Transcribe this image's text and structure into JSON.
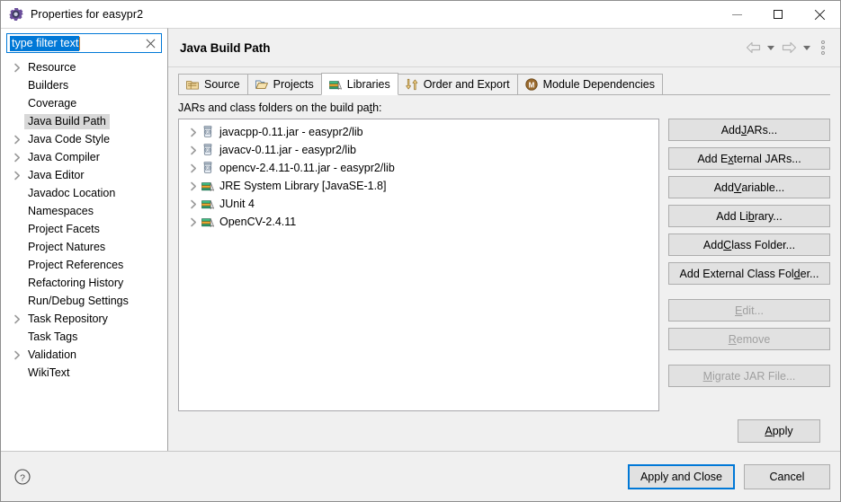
{
  "window": {
    "title": "Properties for easypr2",
    "icon": "properties-gear-icon",
    "minimize_label": "Minimize",
    "maximize_label": "Maximize",
    "close_label": "Close"
  },
  "filter": {
    "value": "type filter text",
    "placeholder": "type filter text",
    "clear_label": "Clear"
  },
  "sidebar": {
    "items": [
      {
        "label": "Resource",
        "expandable": true,
        "selected": false
      },
      {
        "label": "Builders",
        "expandable": false,
        "selected": false
      },
      {
        "label": "Coverage",
        "expandable": false,
        "selected": false
      },
      {
        "label": "Java Build Path",
        "expandable": false,
        "selected": true
      },
      {
        "label": "Java Code Style",
        "expandable": true,
        "selected": false
      },
      {
        "label": "Java Compiler",
        "expandable": true,
        "selected": false
      },
      {
        "label": "Java Editor",
        "expandable": true,
        "selected": false
      },
      {
        "label": "Javadoc Location",
        "expandable": false,
        "selected": false
      },
      {
        "label": "Namespaces",
        "expandable": false,
        "selected": false
      },
      {
        "label": "Project Facets",
        "expandable": false,
        "selected": false
      },
      {
        "label": "Project Natures",
        "expandable": false,
        "selected": false
      },
      {
        "label": "Project References",
        "expandable": false,
        "selected": false
      },
      {
        "label": "Refactoring History",
        "expandable": false,
        "selected": false
      },
      {
        "label": "Run/Debug Settings",
        "expandable": false,
        "selected": false
      },
      {
        "label": "Task Repository",
        "expandable": true,
        "selected": false
      },
      {
        "label": "Task Tags",
        "expandable": false,
        "selected": false
      },
      {
        "label": "Validation",
        "expandable": true,
        "selected": false
      },
      {
        "label": "WikiText",
        "expandable": false,
        "selected": false
      }
    ]
  },
  "page": {
    "title": "Java Build Path",
    "nav": {
      "back_label": "Back",
      "back_menu_label": "Back history",
      "forward_label": "Forward",
      "forward_menu_label": "Forward history",
      "menu_label": "View Menu"
    }
  },
  "tabs": [
    {
      "label": "Source",
      "icon": "source-package-icon",
      "active": false
    },
    {
      "label": "Projects",
      "icon": "projects-folder-icon",
      "active": false
    },
    {
      "label": "Libraries",
      "icon": "libraries-books-icon",
      "active": true
    },
    {
      "label": "Order and Export",
      "icon": "order-export-arrows-icon",
      "active": false
    },
    {
      "label": "Module Dependencies",
      "icon": "module-badge-icon",
      "active": false
    }
  ],
  "libraries": {
    "list_label_prefix": "JARs and class folders on the build pa",
    "list_label_mnemonic": "t",
    "list_label_suffix": "h:",
    "entries": [
      {
        "label": "javacpp-0.11.jar - easypr2/lib",
        "icon": "jar-icon",
        "expandable": true
      },
      {
        "label": "javacv-0.11.jar - easypr2/lib",
        "icon": "jar-icon",
        "expandable": true
      },
      {
        "label": "opencv-2.4.11-0.11.jar - easypr2/lib",
        "icon": "jar-icon",
        "expandable": true
      },
      {
        "label": "JRE System Library [JavaSE-1.8]",
        "icon": "library-icon",
        "expandable": true
      },
      {
        "label": "JUnit 4",
        "icon": "library-icon",
        "expandable": true
      },
      {
        "label": "OpenCV-2.4.11",
        "icon": "library-icon",
        "expandable": true
      }
    ],
    "buttons": [
      {
        "pre": "Add ",
        "mnemonic": "J",
        "post": "ARs...",
        "disabled": false,
        "gap": false
      },
      {
        "pre": "Add E",
        "mnemonic": "x",
        "post": "ternal JARs...",
        "disabled": false,
        "gap": false
      },
      {
        "pre": "Add ",
        "mnemonic": "V",
        "post": "ariable...",
        "disabled": false,
        "gap": false
      },
      {
        "pre": "Add Li",
        "mnemonic": "b",
        "post": "rary...",
        "disabled": false,
        "gap": false
      },
      {
        "pre": "Add ",
        "mnemonic": "C",
        "post": "lass Folder...",
        "disabled": false,
        "gap": false
      },
      {
        "pre": "Add External Class Fol",
        "mnemonic": "d",
        "post": "er...",
        "disabled": false,
        "gap": false
      },
      {
        "pre": "",
        "mnemonic": "E",
        "post": "dit...",
        "disabled": true,
        "gap": true
      },
      {
        "pre": "",
        "mnemonic": "R",
        "post": "emove",
        "disabled": true,
        "gap": false
      },
      {
        "pre": "",
        "mnemonic": "M",
        "post": "igrate JAR File...",
        "disabled": true,
        "gap": true
      }
    ]
  },
  "apply": {
    "pre": "",
    "mnemonic": "A",
    "post": "pply"
  },
  "footer": {
    "help_label": "Help",
    "apply_and_close_label": "Apply and Close",
    "cancel_label": "Cancel"
  },
  "colors": {
    "accent": "#0078d7",
    "selection": "#d8d8d8",
    "dialog_bg": "#f0f0f0",
    "list_bg": "#ffffff",
    "button_bg": "#e1e1e1",
    "disabled_text": "#a0a0a0"
  }
}
